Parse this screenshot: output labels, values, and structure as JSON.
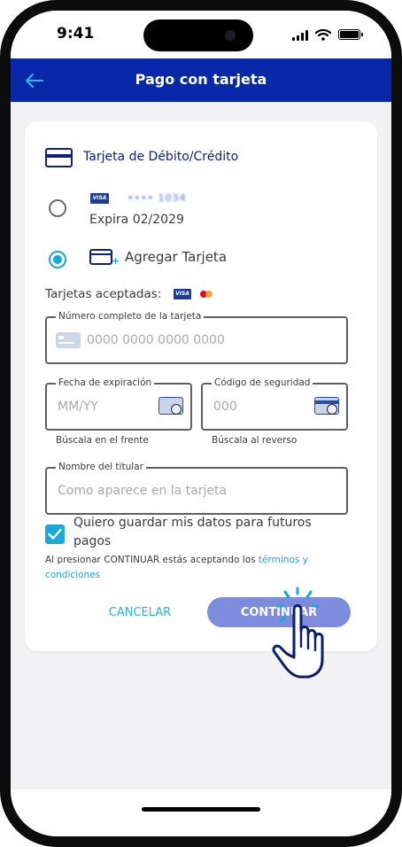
{
  "status_bar": {
    "time": "9:41"
  },
  "header": {
    "title": "Pago con tarjeta"
  },
  "payment": {
    "section_title": "Tarjeta de Débito/Crédito",
    "saved_card": {
      "brand": "VISA",
      "masked_number": "•••• 1034",
      "expiry": "Expira 02/2029",
      "selected": false
    },
    "add_card": {
      "label": "Agregar Tarjeta",
      "selected": true
    },
    "accepted_label": "Tarjetas aceptadas:"
  },
  "form": {
    "card_number": {
      "label": "Número completo de la tarjeta",
      "placeholder": "0000 0000 0000 0000"
    },
    "expiry": {
      "label": "Fecha de expiración",
      "placeholder": "MM/YY",
      "helper": "Búscala en el frente"
    },
    "cvv": {
      "label": "Código de seguridad",
      "placeholder": "000",
      "helper": "Búscala al reverso"
    },
    "holder": {
      "label": "Nombre del titular",
      "placeholder": "Como aparece en la tarjeta"
    }
  },
  "save_data": {
    "label": "Quiero guardar mis datos para futuros pagos",
    "checked": true
  },
  "legal": {
    "text": "Al presionar CONTINUAR estás aceptando los ",
    "link": "términos y condiciones"
  },
  "actions": {
    "cancel": "CANCELAR",
    "continue": "CONTINUAR"
  },
  "colors": {
    "header": "#0728a8",
    "accent": "#1aa8d8",
    "primary_button": "#7d8cdc",
    "brand_blue": "#0a1e8c"
  }
}
